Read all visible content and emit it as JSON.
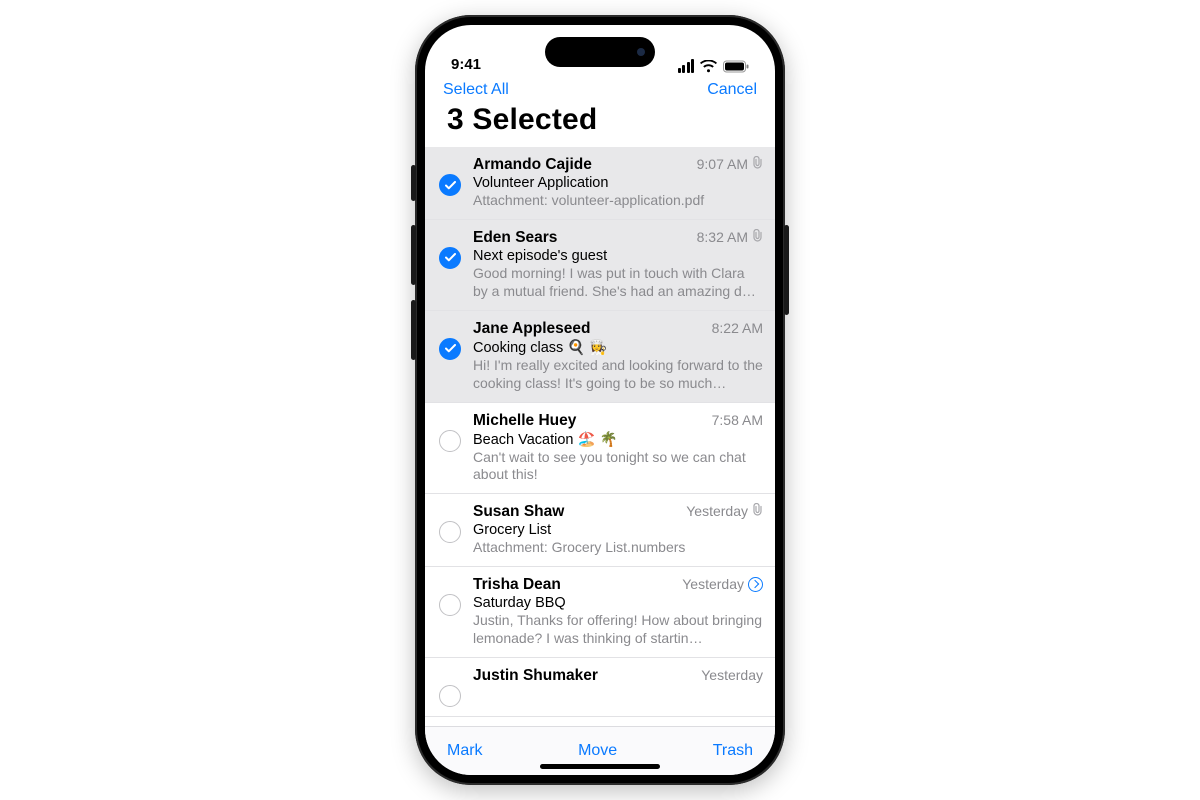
{
  "status": {
    "time": "9:41"
  },
  "nav": {
    "select_all": "Select All",
    "cancel": "Cancel"
  },
  "title": "3 Selected",
  "toolbar": {
    "mark": "Mark",
    "move": "Move",
    "trash": "Trash"
  },
  "messages": [
    {
      "sender": "Armando Cajide",
      "time": "9:07 AM",
      "subject": "Volunteer Application",
      "preview": "Attachment: volunteer-application.pdf",
      "selected": true,
      "has_attachment": true,
      "has_reply": false
    },
    {
      "sender": "Eden Sears",
      "time": "8:32 AM",
      "subject": "Next episode's guest",
      "preview": "Good morning! I was put in touch with Clara by a mutual friend. She's had an amazing d…",
      "selected": true,
      "has_attachment": true,
      "has_reply": false
    },
    {
      "sender": "Jane Appleseed",
      "time": "8:22 AM",
      "subject": "Cooking class 🍳 👩‍🍳",
      "preview": "Hi! I'm really excited and looking forward to the cooking class! It's going to be so much…",
      "selected": true,
      "has_attachment": false,
      "has_reply": false
    },
    {
      "sender": "Michelle Huey",
      "time": "7:58 AM",
      "subject": "Beach Vacation 🏖️ 🌴",
      "preview": "Can't wait to see you tonight so we can chat about this!",
      "selected": false,
      "has_attachment": false,
      "has_reply": false
    },
    {
      "sender": "Susan Shaw",
      "time": "Yesterday",
      "subject": "Grocery List",
      "preview": "Attachment: Grocery List.numbers",
      "selected": false,
      "has_attachment": true,
      "has_reply": false
    },
    {
      "sender": "Trisha Dean",
      "time": "Yesterday",
      "subject": "Saturday BBQ",
      "preview": "Justin, Thanks for offering! How about bringing lemonade? I was thinking of startin…",
      "selected": false,
      "has_attachment": false,
      "has_reply": true
    },
    {
      "sender": "Justin Shumaker",
      "time": "Yesterday",
      "subject": "",
      "preview": "",
      "selected": false,
      "has_attachment": false,
      "has_reply": false
    }
  ]
}
